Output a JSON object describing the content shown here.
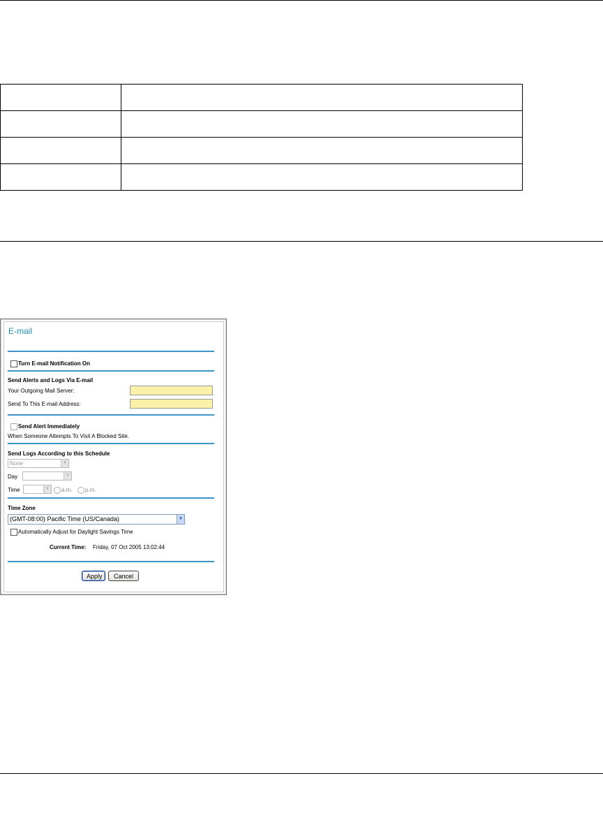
{
  "table": {
    "rows": [
      [
        "",
        ""
      ],
      [
        "",
        ""
      ],
      [
        "",
        ""
      ],
      [
        "",
        ""
      ]
    ]
  },
  "email_panel": {
    "title": "E-mail",
    "notification_label": "Turn E-mail Notification On",
    "alerts_heading": "Send Alerts and Logs Via E-mail",
    "mail_server_label": "Your Outgoing Mail Server:",
    "mail_server_value": "",
    "email_address_label": "Send To This E-mail Address:",
    "email_address_value": "",
    "send_alert_label": "Send Alert Immediately",
    "blocked_site_text": "When Someone Attempts To Visit A Blocked Site.",
    "schedule_heading": "Send Logs According to this Schedule",
    "schedule_selected": "None",
    "day_label": "Day",
    "day_selected": "",
    "time_label": "Time",
    "time_selected": "",
    "am_label": "a.m.",
    "pm_label": "p.m.",
    "timezone_heading": "Time Zone",
    "timezone_selected": "(GMT-08:00) Pacific Time (US/Canada)",
    "dst_label": "Automatically Adjust for Daylight Savings Time",
    "current_time_label": "Current Time:",
    "current_time_value": "Friday, 07 Oct 2005 13:02:44",
    "apply_label": "Apply",
    "cancel_label": "Cancel"
  },
  "colors": {
    "accent": "#1b8fb5",
    "separator": "#3c95c7",
    "input_fill": "#fbf1a8"
  }
}
